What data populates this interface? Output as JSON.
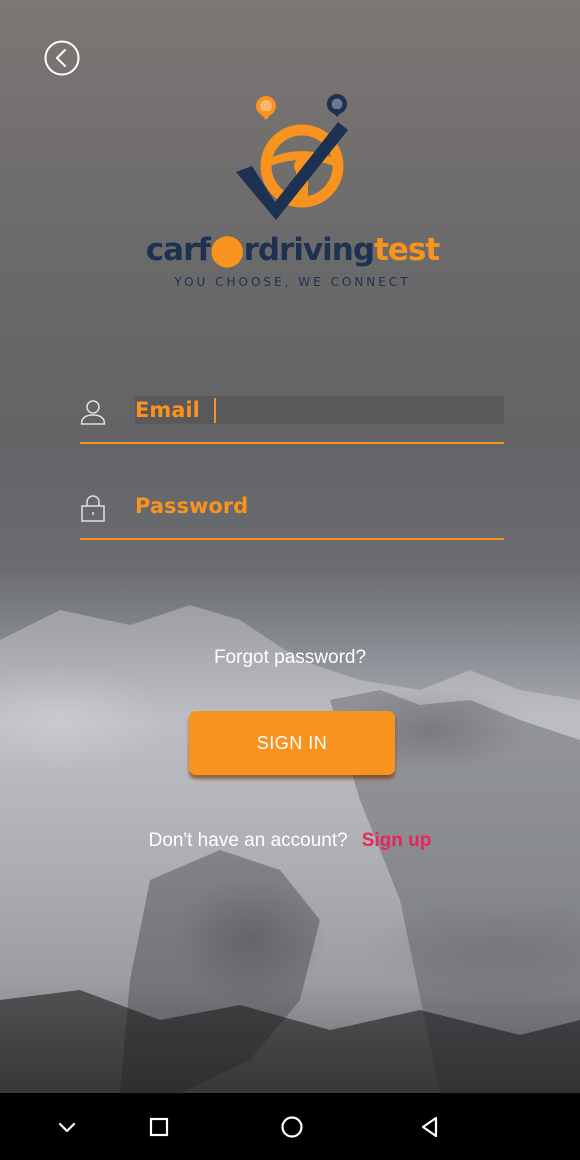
{
  "brand": {
    "name_part1": "carf",
    "name_part2": "rdriving",
    "name_part3": "test",
    "tagline": "YOU CHOOSE, WE CONNECT",
    "logo_icon": "steering-wheel-checkmark-logo"
  },
  "form": {
    "email_placeholder": "Email",
    "email_value": "",
    "password_placeholder": "Password",
    "password_value": ""
  },
  "actions": {
    "forgot_password": "Forgot password?",
    "sign_in": "SIGN IN",
    "no_account_prompt": "Don't have an account?",
    "sign_up": "Sign up"
  },
  "icons": {
    "back": "back-arrow-circle-icon",
    "user": "user-icon",
    "lock": "lock-icon",
    "nav_down": "chevron-down-icon",
    "nav_recents": "recents-square-icon",
    "nav_home": "home-circle-icon",
    "nav_back": "back-triangle-icon"
  },
  "colors": {
    "accent": "#f7931e",
    "brand_navy": "#1d3152",
    "link_pink": "#e8265a"
  }
}
